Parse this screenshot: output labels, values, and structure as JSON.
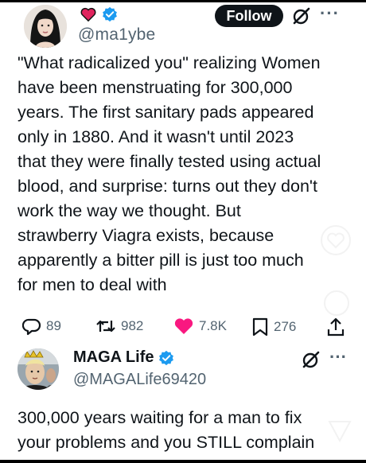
{
  "tweet1": {
    "handle": "@ma1ybe",
    "follow_label": "Follow",
    "more_label": "···",
    "text": "\"What radicalized you\" realizing Women\nhave been menstruating for 300,000\nyears. The first sanitary pads appeared\nonly in 1880. And it wasn't until 2023\nthat they were finally tested using actual\nblood, and surprise: turns out they don't\nwork the way we thought. But\nstrawberry Viagra exists, because\napparently a bitter pill is just too much\nfor men to deal with",
    "stats": {
      "replies": "89",
      "reposts": "982",
      "likes": "7.8K",
      "bookmarks": "276"
    }
  },
  "tweet2": {
    "name": "MAGA Life",
    "handle": "@MAGALife69420",
    "more_label": "···",
    "text": "300,000 years waiting for a man to fix\nyour problems and you STILL complain"
  },
  "colors": {
    "text": "#0f1419",
    "secondary": "#536471",
    "verified": "#1d9bf0",
    "like": "#f91880",
    "heart_badge": "#e0245e"
  },
  "icons": {
    "heart_badge": "heart-icon",
    "verified": "verified-badge-icon",
    "grok": "grok-icon",
    "reply": "reply-icon",
    "repost": "repost-icon",
    "like": "like-heart-icon",
    "bookmark": "bookmark-icon",
    "share": "share-icon"
  }
}
